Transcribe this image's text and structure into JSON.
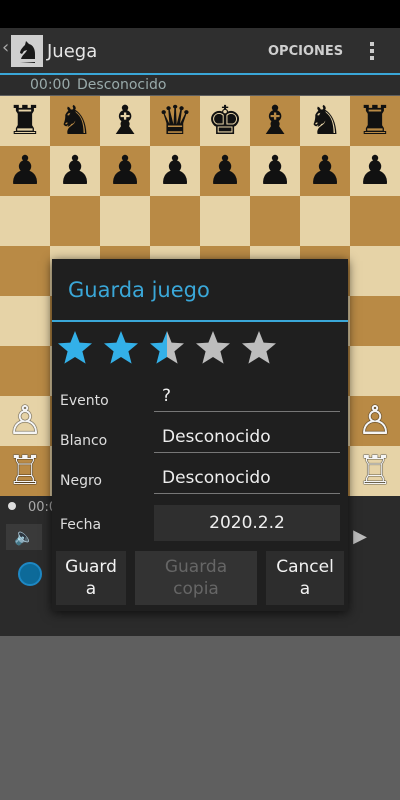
{
  "app": {
    "title": "Juega",
    "menu_label": "OPCIONES",
    "clock": "00:00",
    "player": "Desconocido",
    "bottom_clock": "00:0"
  },
  "board": {
    "rows": [
      [
        "♜",
        "♞",
        "♝",
        "♛",
        "♚",
        "♝",
        "♞",
        "♜"
      ],
      [
        "♟",
        "♟",
        "♟",
        "♟",
        "♟",
        "♟",
        "♟",
        "♟"
      ],
      [
        "",
        "",
        "",
        "",
        "",
        "",
        "",
        ""
      ],
      [
        "",
        "",
        "",
        "",
        "",
        "",
        "",
        ""
      ],
      [
        "",
        "",
        "",
        "",
        "",
        "",
        "",
        ""
      ],
      [
        "",
        "",
        "",
        "",
        "",
        "",
        "",
        ""
      ],
      [
        "♙",
        "",
        "",
        "",
        "",
        "",
        "",
        "♙"
      ],
      [
        "♖",
        "",
        "",
        "",
        "",
        "",
        "",
        "♖"
      ]
    ],
    "light_color": "#e6d3a7",
    "dark_color": "#b98a45"
  },
  "dialog": {
    "title": "Guarda juego",
    "rating": 2.5,
    "rating_max": 5,
    "fields": {
      "event_label": "Evento",
      "event_value": "?",
      "white_label": "Blanco",
      "white_value": "Desconocido",
      "black_label": "Negro",
      "black_value": "Desconocido",
      "date_label": "Fecha",
      "date_value": "2020.2.2"
    },
    "buttons": {
      "save": "Guarda",
      "save_copy": "Guarda copia",
      "cancel": "Cancela"
    },
    "accent_color": "#3aa7d8"
  }
}
